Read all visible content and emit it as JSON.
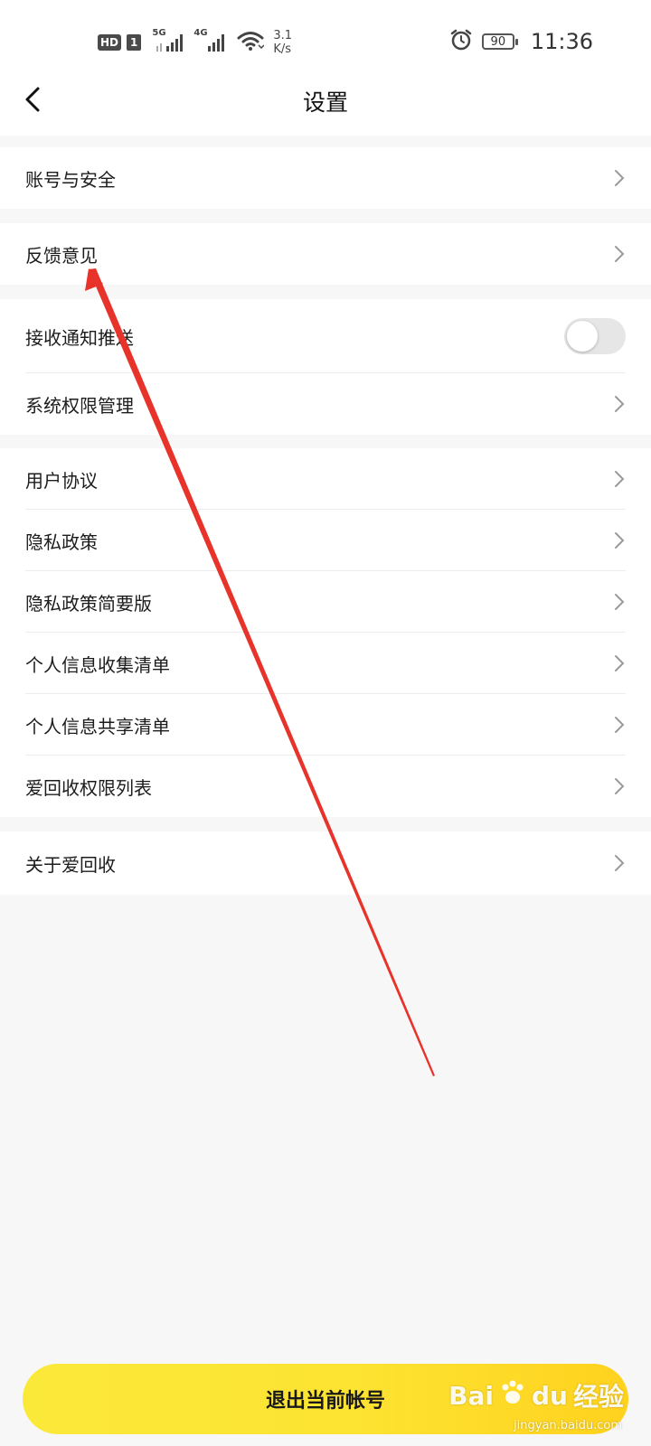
{
  "status_bar": {
    "hd": "HD",
    "sim": "1",
    "net1": "5G",
    "net2": "4G",
    "speed_value": "3.1",
    "speed_unit": "K/s",
    "battery": "90",
    "time": "11:36",
    "icons": [
      "signal-5g-icon",
      "signal-4g-icon",
      "wifi-icon",
      "alarm-icon",
      "battery-icon"
    ]
  },
  "header": {
    "title": "设置",
    "back_icon": "chevron-left-icon"
  },
  "settings": {
    "account_security": "账号与安全",
    "feedback": "反馈意见",
    "notification_push": "接收通知推送",
    "notification_push_enabled": false,
    "system_permissions": "系统权限管理",
    "user_agreement": "用户协议",
    "privacy_policy": "隐私政策",
    "privacy_policy_brief": "隐私政策简要版",
    "personal_info_collection": "个人信息收集清单",
    "personal_info_sharing": "个人信息共享清单",
    "permission_list": "爱回收权限列表",
    "about": "关于爱回收"
  },
  "logout": {
    "label": "退出当前帐号"
  },
  "watermark": {
    "brand": "Bai",
    "brand2": "du",
    "suffix": "经验",
    "url": "jingyan.baidu.com"
  },
  "colors": {
    "accent_yellow": "#fde332",
    "annotation_red": "#e8332a",
    "background": "#f7f7f7",
    "toggle_off": "#e6e6e6"
  }
}
